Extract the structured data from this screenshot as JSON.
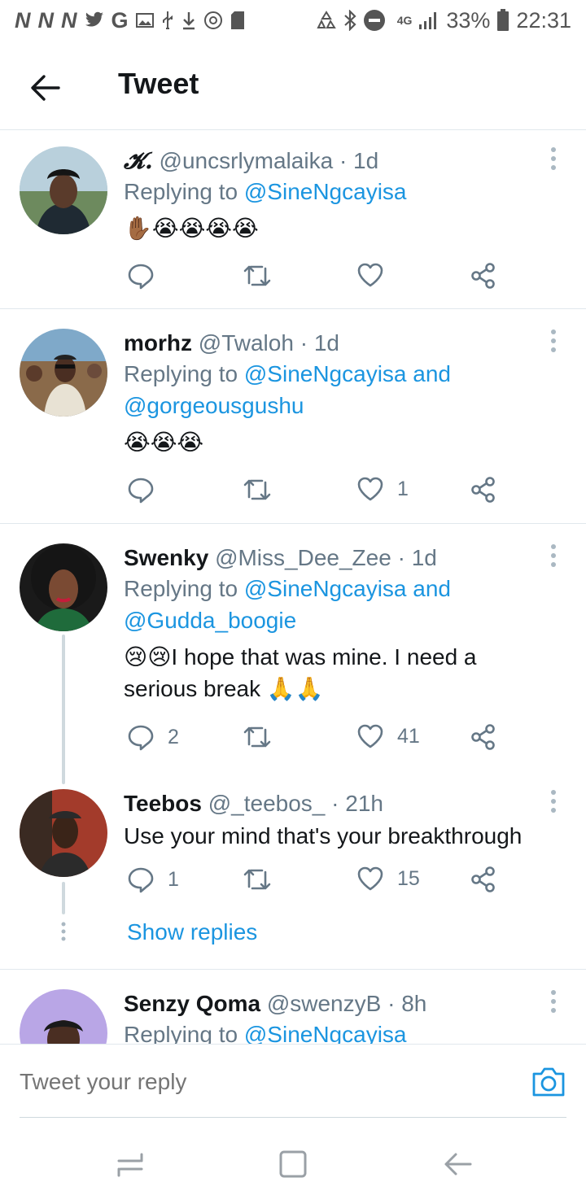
{
  "status": {
    "battery_percent": "33%",
    "time": "22:31",
    "network": "4G"
  },
  "header": {
    "title": "Tweet"
  },
  "tweets": [
    {
      "name": "𝓚.",
      "handle": "@uncsrlymalaika",
      "age": "1d",
      "replying_prefix": "Replying to",
      "mentions": "@SineNgcayisa",
      "body": "✋🏾😭😭😭😭",
      "reply_count": "",
      "like_count": ""
    },
    {
      "name": "morhz",
      "handle": "@Twaloh",
      "age": "1d",
      "replying_prefix": "Replying to",
      "mentions_line1": "@SineNgcayisa",
      "mentions_and": "and",
      "mentions_line2": "@gorgeousgushu",
      "body": "😭😭😭",
      "reply_count": "",
      "like_count": "1"
    },
    {
      "name": "Swenky",
      "handle": "@Miss_Dee_Zee",
      "age": "1d",
      "replying_prefix": "Replying to",
      "mentions_line1": "@SineNgcayisa",
      "mentions_and": "and",
      "mentions_line2": "@Gudda_boogie",
      "body_line1": "😢😢I hope that was mine. I need a",
      "body_line2": "serious break 🙏🙏",
      "reply_count": "2",
      "like_count": "41"
    },
    {
      "name": "Teebos",
      "handle": "@_teebos_",
      "age": "21h",
      "body": "Use your mind that's your breakthrough",
      "reply_count": "1",
      "like_count": "15",
      "show_replies": "Show replies"
    },
    {
      "name": "Senzy Qoma",
      "handle": "@swenzyB",
      "age": "8h",
      "replying_prefix": "Replying to",
      "mentions": "@SineNgcayisa"
    }
  ],
  "compose": {
    "placeholder": "Tweet your reply"
  },
  "colors": {
    "accent": "#1b95e0",
    "secondary_text": "#657786",
    "divider": "#e1e8ed"
  }
}
